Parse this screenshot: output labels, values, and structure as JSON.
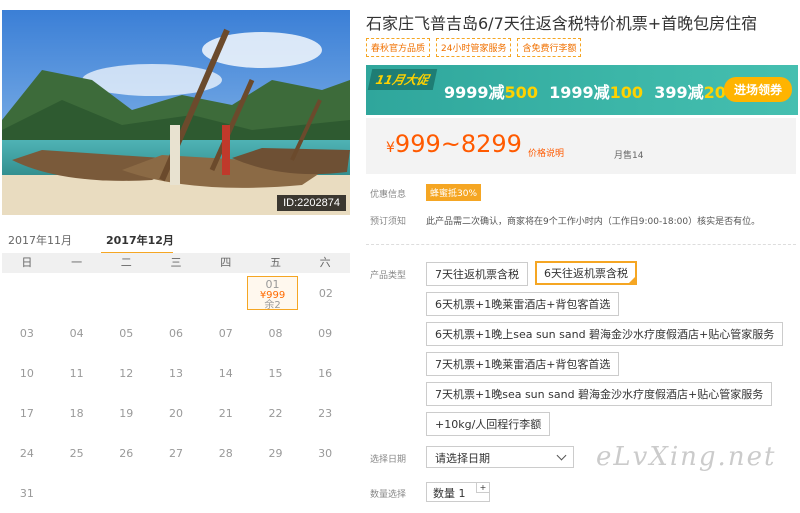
{
  "hero": {
    "image_id": "ID:2202874"
  },
  "calendar": {
    "months": [
      "2017年11月",
      "2017年12月"
    ],
    "weekdays": [
      "日",
      "一",
      "二",
      "三",
      "四",
      "五",
      "六"
    ],
    "weeks": [
      [
        "",
        "",
        "",
        "",
        "",
        "01",
        "02"
      ],
      [
        "03",
        "04",
        "05",
        "06",
        "07",
        "08",
        "09"
      ],
      [
        "10",
        "11",
        "12",
        "13",
        "14",
        "15",
        "16"
      ],
      [
        "17",
        "18",
        "19",
        "20",
        "21",
        "22",
        "23"
      ],
      [
        "24",
        "25",
        "26",
        "27",
        "28",
        "29",
        "30"
      ],
      [
        "31",
        "",
        "",
        "",
        "",
        "",
        ""
      ]
    ],
    "active_day": {
      "day": "01",
      "price": "¥999",
      "remain": "余2"
    }
  },
  "product": {
    "title": "石家庄飞普吉岛6/7天往返含税特价机票+首晚包房住宿",
    "tags": [
      "春秋官方品质",
      "24小时管家服务",
      "含免费行李额"
    ],
    "promo": {
      "badge": "11月大促",
      "deals": [
        {
          "prefix": "9999减",
          "amount": "500"
        },
        {
          "prefix": "1999减",
          "amount": "100"
        },
        {
          "prefix": "399减",
          "amount": "20"
        }
      ],
      "cta": "进场领券"
    },
    "price": {
      "currency": "¥",
      "range": "999~8299",
      "explain": "价格说明",
      "sold": "月售14"
    },
    "discount_label": "优惠信息",
    "coupon": "蜂蜜抵30%",
    "notice_label": "预订须知",
    "notice": "此产品需二次确认，商家将在9个工作小时内（工作日9:00-18:00）核实是否有位。",
    "type_label": "产品类型",
    "options": [
      "7天往返机票含税",
      "6天往返机票含税",
      "6天机票+1晚莱雷酒店+背包客首选",
      "6天机票+1晚上sea sun sand 碧海金沙水疗度假酒店+贴心管家服务",
      "7天机票+1晚莱雷酒店+背包客首选",
      "7天机票+1晚sea sun sand 碧海金沙水疗度假酒店+贴心管家服务",
      "+10kg/人回程行李额"
    ],
    "date_label": "选择日期",
    "date_placeholder": "请选择日期",
    "qty_label": "数量选择",
    "qty_text": "数量",
    "qty_value": "1"
  },
  "watermark": "eLvXing.net",
  "colors": {
    "accent": "#f5a623",
    "price": "#ff5a00",
    "promo_bg": "#3cb6a8"
  }
}
